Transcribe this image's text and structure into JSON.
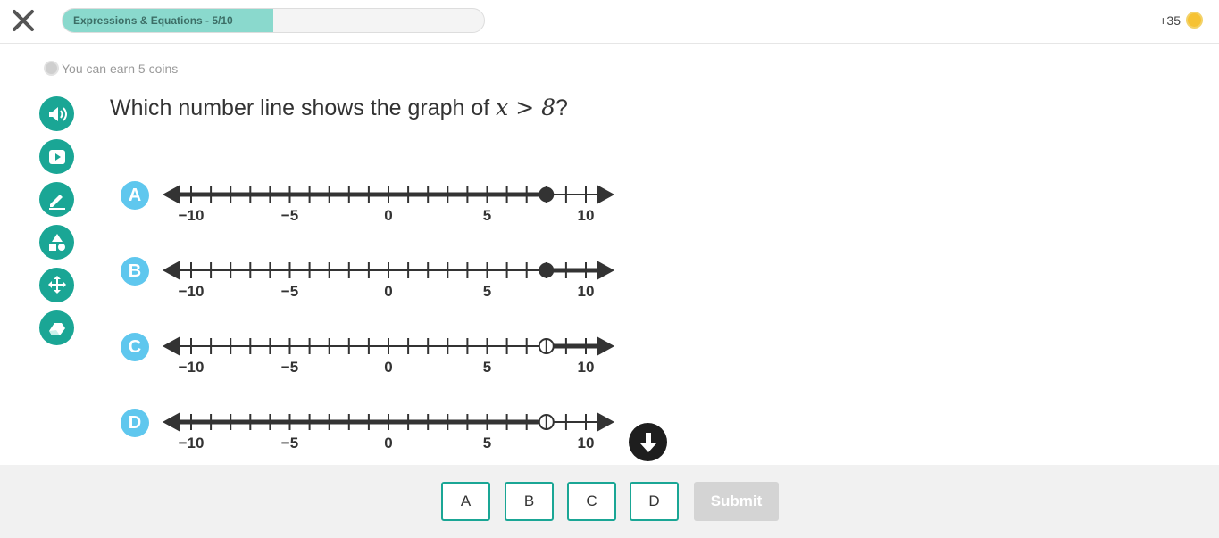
{
  "header": {
    "progress_label": "Expressions & Equations - 5/10",
    "progress_fraction": 0.5,
    "coins_label": "+35"
  },
  "earn_label": "You can earn 5 coins",
  "tools": [
    {
      "name": "read-aloud-icon"
    },
    {
      "name": "video-icon"
    },
    {
      "name": "pencil-icon"
    },
    {
      "name": "shapes-icon"
    },
    {
      "name": "move-icon"
    },
    {
      "name": "eraser-icon"
    }
  ],
  "question": {
    "prefix": "Which number line shows the graph of ",
    "math": "x > 8",
    "suffix": "?"
  },
  "number_lines": {
    "min": -11,
    "max": 11,
    "tick_labels": [
      "−10",
      "−5",
      "0",
      "5",
      "10"
    ],
    "tick_label_values": [
      -10,
      -5,
      0,
      5,
      10
    ],
    "choices": [
      {
        "letter": "A",
        "point": 8,
        "closed": true,
        "direction": "left"
      },
      {
        "letter": "B",
        "point": 8,
        "closed": true,
        "direction": "right"
      },
      {
        "letter": "C",
        "point": 8,
        "closed": false,
        "direction": "right"
      },
      {
        "letter": "D",
        "point": 8,
        "closed": false,
        "direction": "left"
      }
    ]
  },
  "answers": [
    "A",
    "B",
    "C",
    "D"
  ],
  "submit_label": "Submit",
  "colors": {
    "teal": "#1aa695",
    "badge_blue": "#5fc7ee",
    "progress_fill": "#8ad9cd",
    "line": "#333333"
  }
}
